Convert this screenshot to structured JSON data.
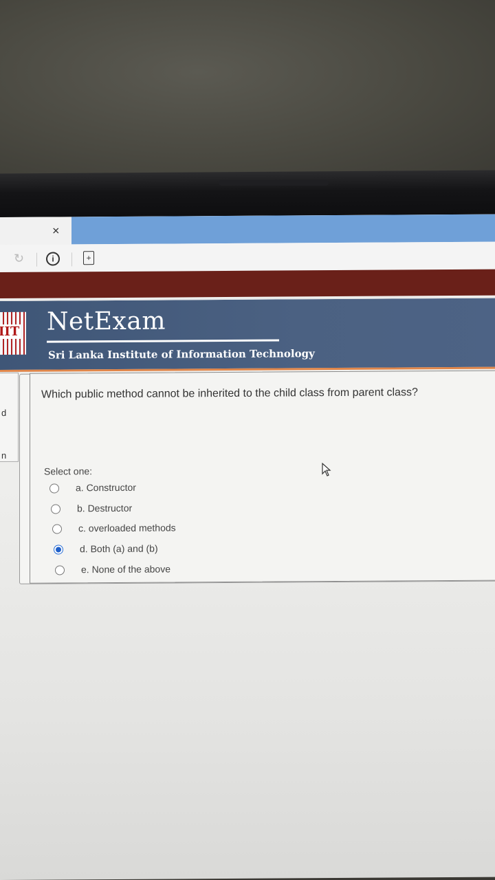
{
  "browser": {
    "close_glyph": "×",
    "reload_glyph": "↻",
    "info_glyph": "i",
    "doc_glyph": "+"
  },
  "site": {
    "logo_text": "IIT",
    "brand": "NetExam",
    "subtitle": "Sri Lanka Institute of Information Technology"
  },
  "side_tab": {
    "letter_a": "d",
    "letter_b": "n"
  },
  "quiz": {
    "question": "Which public method cannot be inherited to the child class from parent class?",
    "select_label": "Select one:",
    "options": [
      {
        "label": "a. Constructor",
        "selected": false
      },
      {
        "label": "b. Destructor",
        "selected": false
      },
      {
        "label": "c. overloaded methods",
        "selected": false
      },
      {
        "label": "d. Both (a) and (b)",
        "selected": true
      },
      {
        "label": "e. None of the above",
        "selected": false
      }
    ]
  },
  "colors": {
    "maroon": "#6a2019",
    "banner": "#4b6182",
    "accent": "#e0864a",
    "radio_selected": "#1f5fc8"
  }
}
